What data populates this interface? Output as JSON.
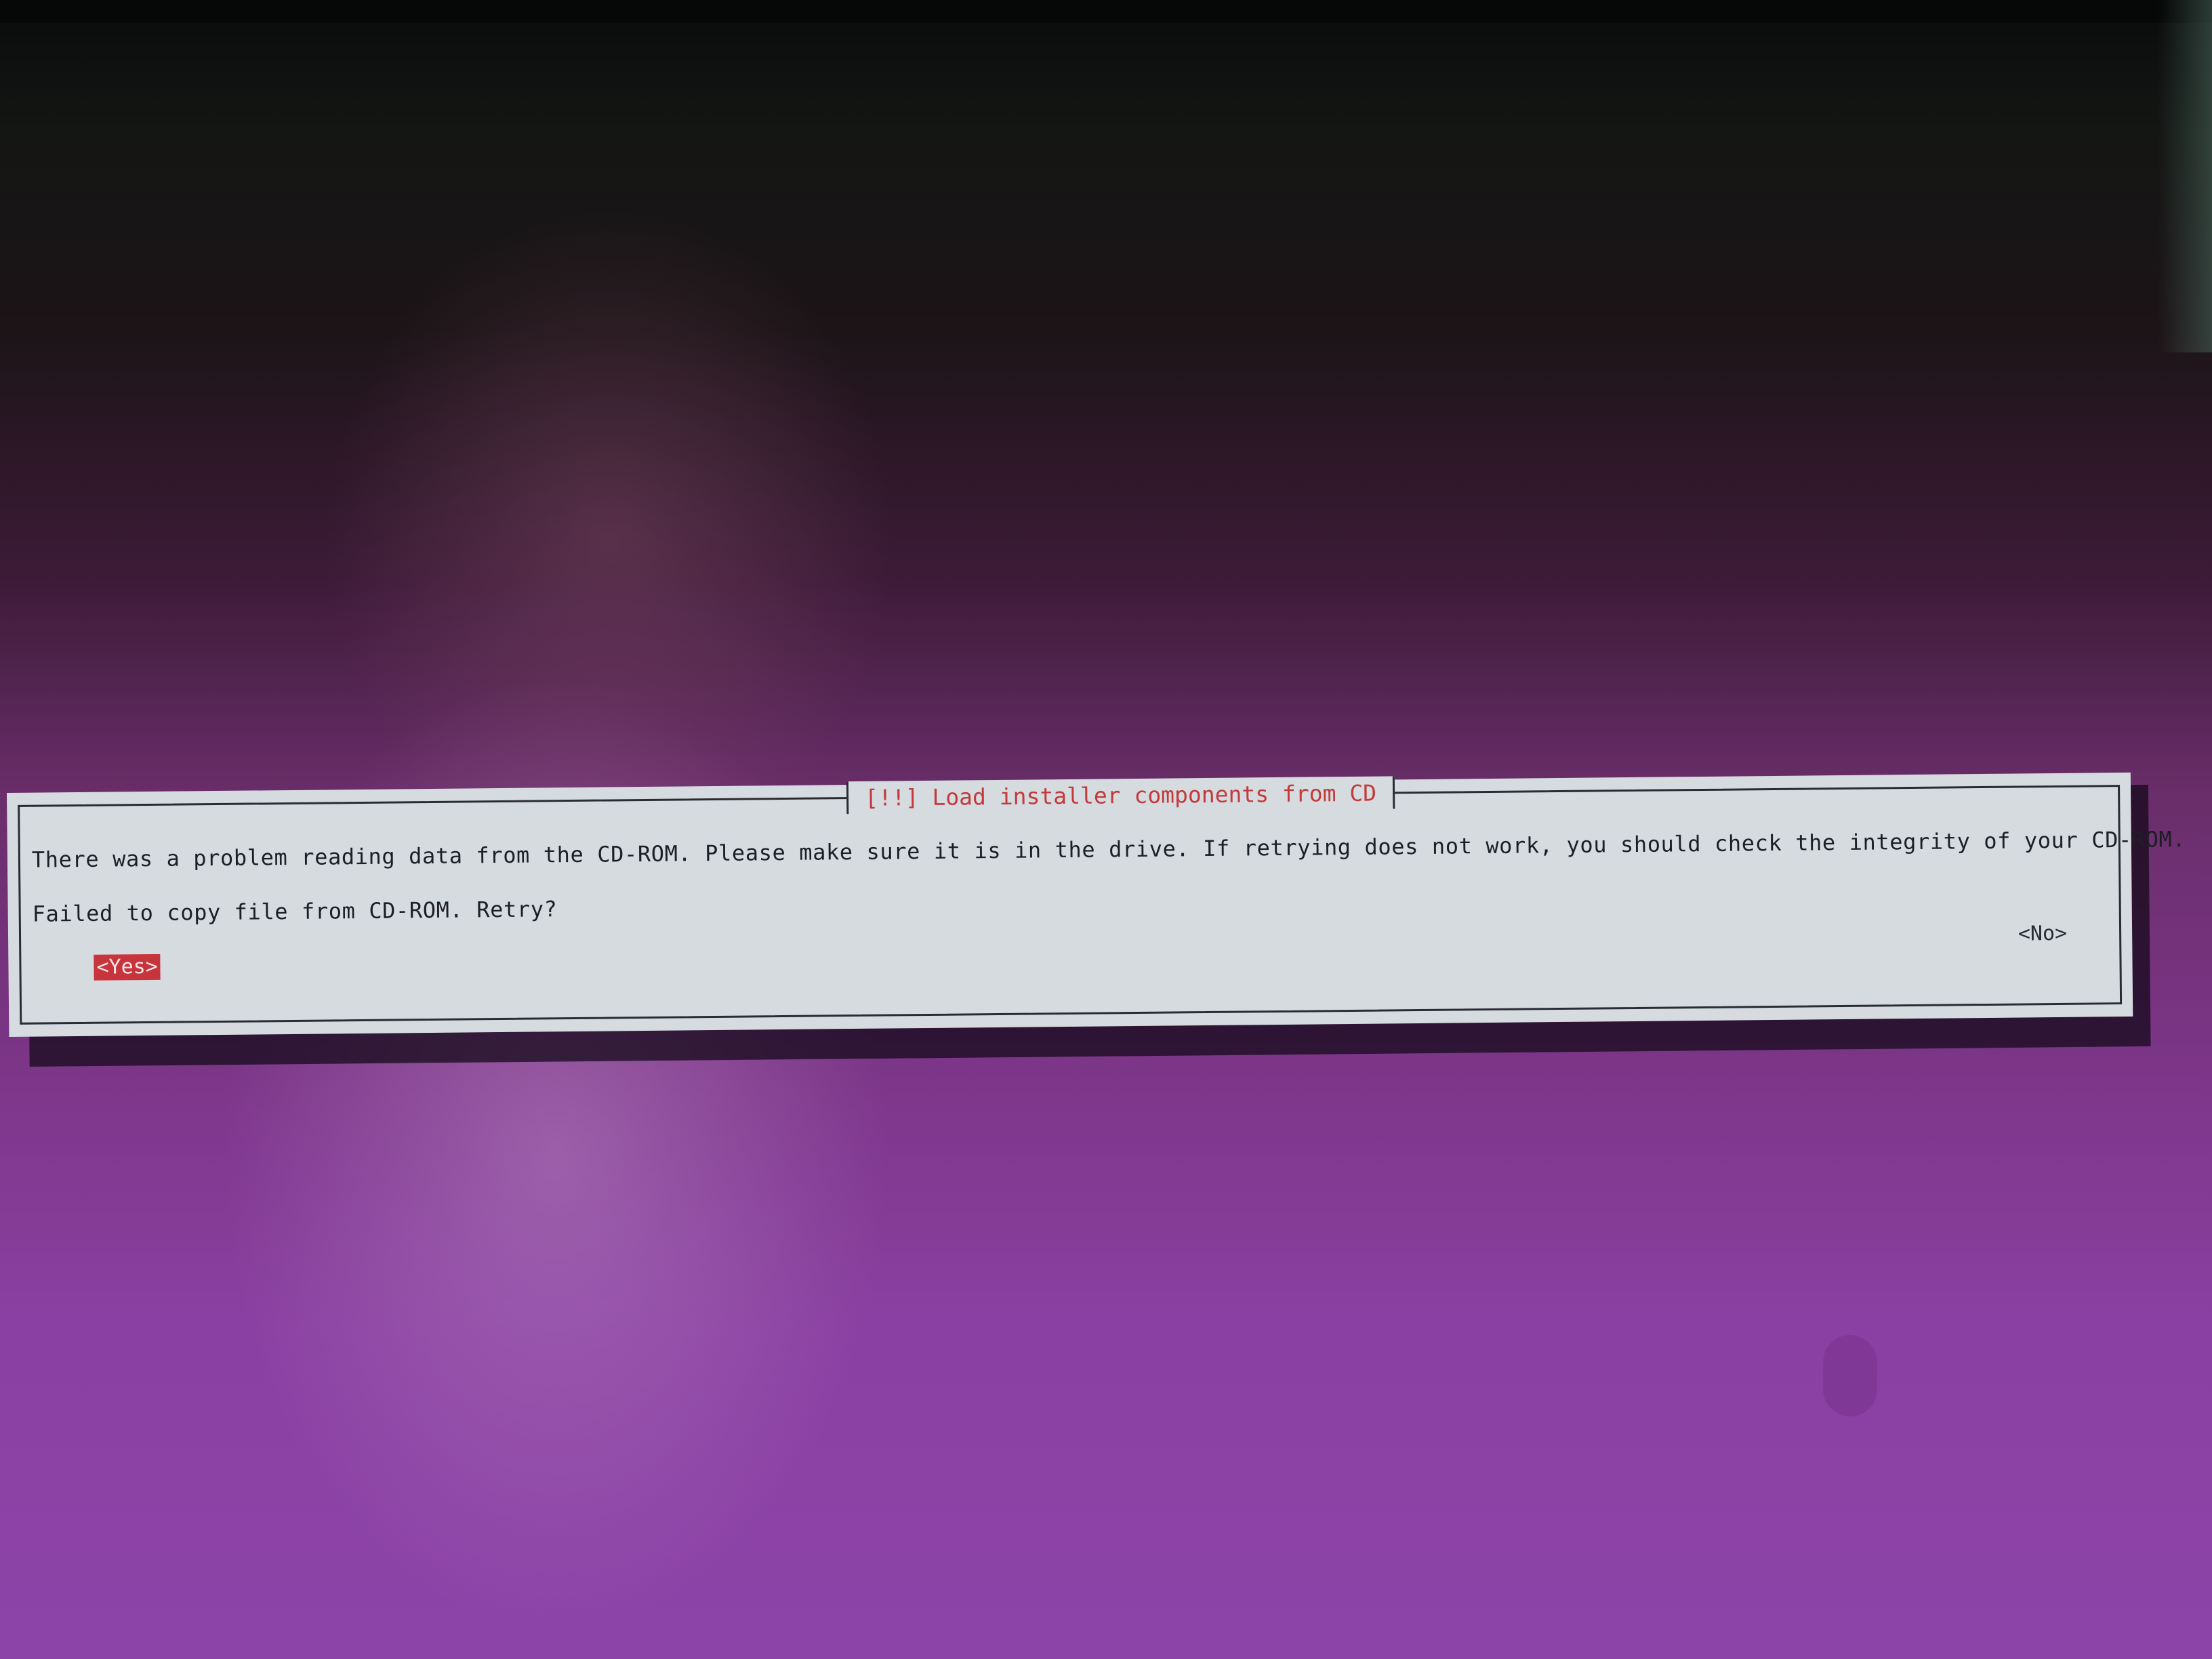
{
  "dialog": {
    "title": "[!!] Load installer components from CD",
    "message": "There was a problem reading data from the CD-ROM. Please make sure it is in the drive. If retrying does not work, you should check the integrity of your CD-ROM.",
    "question": "Failed to copy file from CD-ROM. Retry?",
    "yes_label": "<Yes>",
    "no_label": "<No>"
  },
  "colors": {
    "dialog_background": "#d6dbe0",
    "title_text": "#c23a3a",
    "selected_button": "#c8343c",
    "desktop_purple": "#8a40a2"
  }
}
